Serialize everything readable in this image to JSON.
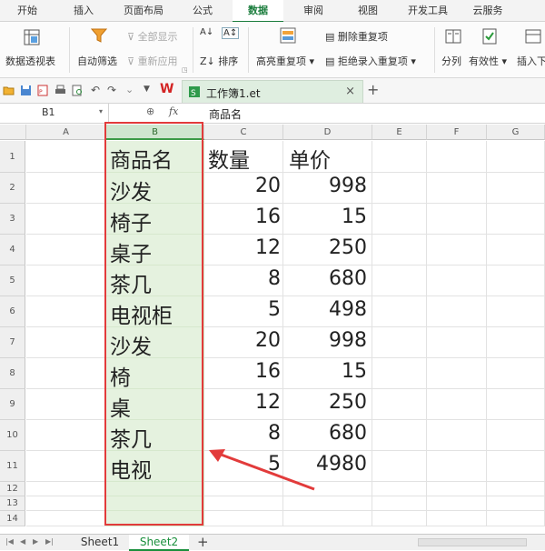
{
  "ribbon_tabs": [
    "开始",
    "插入",
    "页面布局",
    "公式",
    "数据",
    "审阅",
    "视图",
    "开发工具",
    "云服务"
  ],
  "active_tab": "数据",
  "ribbon": {
    "pivot": "数据透视表",
    "autofilter": "自动筛选",
    "show_all": "全部显示",
    "reapply": "重新应用",
    "sort": "排序",
    "highlight_dup": "高亮重复项",
    "remove_dup": "删除重复项",
    "reject_dup": "拒绝录入重复项",
    "split": "分列",
    "validity": "有效性",
    "insert": "插入下"
  },
  "doc_tab": {
    "name": "工作簿1.et",
    "close": "×",
    "add": "+"
  },
  "formula_bar": {
    "name_box": "B1",
    "fx": "fx",
    "content": "商品名"
  },
  "columns": [
    "A",
    "B",
    "C",
    "D",
    "E",
    "F",
    "G"
  ],
  "selected_column": "B",
  "rows": [
    "1",
    "2",
    "3",
    "4",
    "5",
    "6",
    "7",
    "8",
    "9",
    "10",
    "11",
    "12",
    "13",
    "14"
  ],
  "table": {
    "headers": [
      "商品名",
      "数量",
      "单价"
    ],
    "data": [
      [
        "沙发",
        "20",
        "998"
      ],
      [
        "椅子",
        "16",
        "15"
      ],
      [
        "桌子",
        "12",
        "250"
      ],
      [
        "茶几",
        "8",
        "680"
      ],
      [
        "电视柜",
        "5",
        "498"
      ],
      [
        "沙发",
        "20",
        "998"
      ],
      [
        "椅",
        "16",
        "15"
      ],
      [
        "桌",
        "12",
        "250"
      ],
      [
        "茶几",
        "8",
        "680"
      ],
      [
        "电视",
        "5",
        "4980"
      ]
    ]
  },
  "sheets": [
    "Sheet1",
    "Sheet2"
  ],
  "active_sheet": "Sheet2",
  "colors": {
    "accent": "#1a7c3c",
    "highlight": "#e23b3b",
    "selection": "#e5f2df"
  }
}
